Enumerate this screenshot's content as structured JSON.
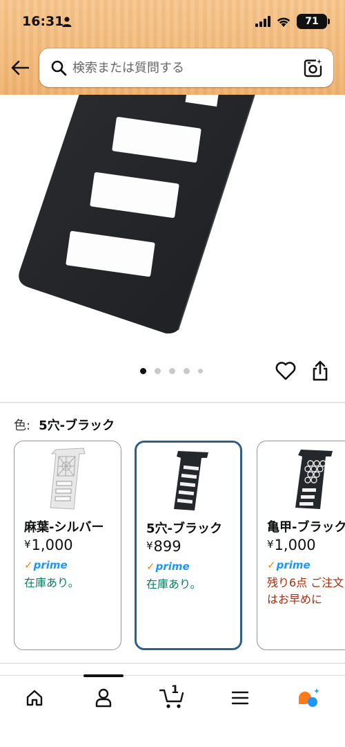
{
  "status_bar": {
    "time": "16:31",
    "battery": "71"
  },
  "header": {
    "search_placeholder": "検索または質問する"
  },
  "colors": {
    "selected_border": "#2e5e8c",
    "in_stock": "#067d62",
    "low_stock": "#b12704",
    "prime_blue": "#1a98ff",
    "prime_check": "#f08804"
  },
  "product_gallery": {
    "image_count": 5,
    "active_index": 0
  },
  "variation": {
    "label": "色:",
    "selected_value": "5穴-ブラック",
    "options": [
      {
        "name": "麻葉-シルバー",
        "currency": "¥",
        "price": "1,000",
        "prime": "prime",
        "stock": "在庫あり。",
        "selected": false
      },
      {
        "name": "5穴-ブラック",
        "currency": "¥",
        "price": "899",
        "prime": "prime",
        "stock": "在庫あり。",
        "selected": true
      },
      {
        "name": "亀甲-ブラック",
        "currency": "¥",
        "price": "1,000",
        "prime": "prime",
        "stock": "残り6点 ご注文はお早めに",
        "selected": false
      }
    ]
  },
  "bottom_nav": {
    "items": [
      "home-icon",
      "account-icon",
      "cart-icon",
      "menu-icon",
      "rufus-icon"
    ],
    "cart_count": "1"
  }
}
